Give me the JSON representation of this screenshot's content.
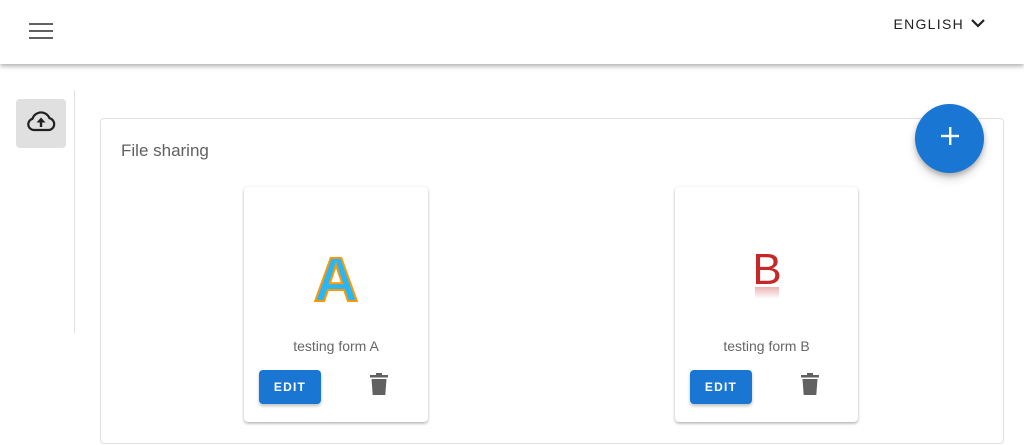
{
  "header": {
    "menu_icon": "hamburger-menu-icon",
    "language_label": "ENGLISH",
    "language_icon": "chevron-down-icon"
  },
  "sidebar": {
    "upload_icon": "cloud-upload-icon"
  },
  "main": {
    "section_title": "File sharing",
    "fab_icon": "plus-icon",
    "cards": [
      {
        "thumbnail_letter": "A",
        "title": "testing form A",
        "edit_label": "EDIT",
        "delete_icon": "trash-icon"
      },
      {
        "thumbnail_letter": "B",
        "title": "testing form B",
        "edit_label": "EDIT",
        "delete_icon": "trash-icon"
      }
    ]
  },
  "colors": {
    "primary": "#1976d2",
    "letter_a_fill": "#29b6f6",
    "letter_a_outline": "#ff9800",
    "letter_b": "#c62828",
    "icon_gray": "#616161"
  }
}
